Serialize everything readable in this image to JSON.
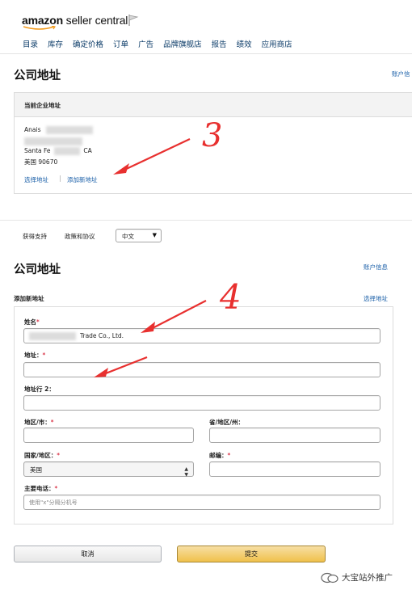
{
  "brand": {
    "amazon": "amazon",
    "seller_central": "seller central"
  },
  "nav": [
    "目录",
    "库存",
    "确定价格",
    "订单",
    "广告",
    "品牌旗舰店",
    "报告",
    "绩效",
    "应用商店"
  ],
  "page_title": "公司地址",
  "account_info_top": "账户信",
  "current_address": {
    "header": "当前企业地址",
    "line1": "Anais",
    "line2_start": "Santa Fe",
    "line2_end": "CA",
    "line3": "美国 90670",
    "choose_link": "选择地址",
    "separator": "|",
    "add_link": "添加新地址"
  },
  "annotations": {
    "three": "3",
    "four": "4"
  },
  "footer": {
    "support": "获得支持",
    "policies": "政策和协议",
    "language": "中文"
  },
  "form": {
    "title": "公司地址",
    "account_info": "账户信息",
    "subtitle": "添加新地址",
    "choose_address": "选择地址",
    "name_label": "姓名",
    "name_value": "Trade Co., Ltd.",
    "address_label": "地址：",
    "address2_label": "地址行 2：",
    "district_label": "地区/市：",
    "province_label": "省/地区/州：",
    "country_label": "国家/地区：",
    "country_value": "美国",
    "zip_label": "邮编：",
    "phone_label": "主要电话：",
    "phone_placeholder": "使用\"x\"分隔分机号",
    "required_mark": "*"
  },
  "buttons": {
    "cancel": "取消",
    "submit": "提交"
  },
  "watermark": "大宝站外推广",
  "colors": {
    "link": "#1a5fa8",
    "submit": "#f0c14b",
    "arrow": "#e8302f"
  }
}
